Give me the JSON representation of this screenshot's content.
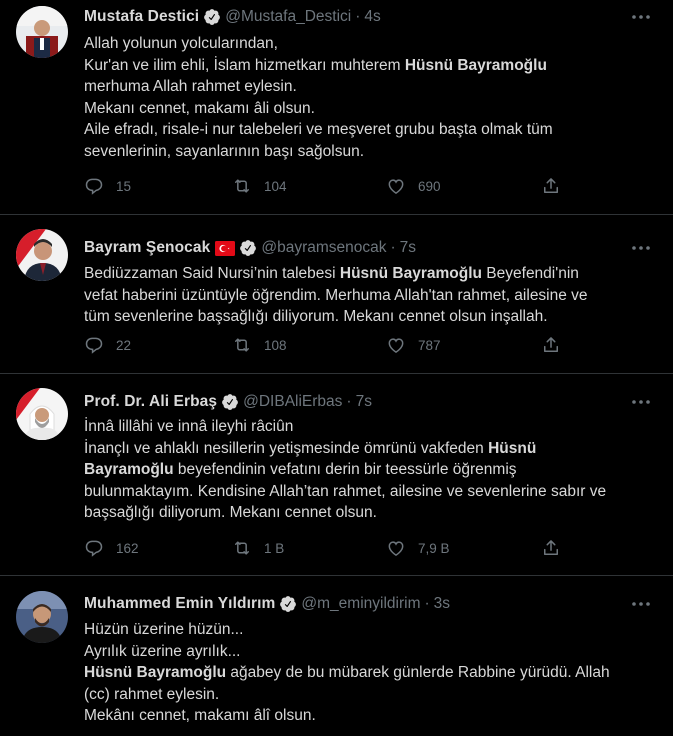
{
  "tweets": [
    {
      "name": "Mustafa Destici",
      "handle": "@Mustafa_Destici",
      "dot": "·",
      "time": "4s",
      "lines": [
        [
          "Allah yolunun yolcularından,"
        ],
        [
          "Kur'an ve ilim ehli, İslam hizmetkarı muhterem ",
          "Hüsnü Bayramoğlu"
        ],
        [
          "merhuma Allah rahmet eylesin."
        ],
        [
          "Mekanı cennet, makamı âli olsun."
        ],
        [
          "Aile efradı, risale-i nur talebeleri ve meşveret grubu  başta olmak tüm"
        ],
        [
          "sevenlerinin, sayanlarının başı sağolsun."
        ]
      ],
      "replies": "15",
      "retweets": "104",
      "likes": "690"
    },
    {
      "name": "Bayram Şenocak",
      "handle": "@bayramsenocak",
      "dot": "·",
      "time": "7s",
      "lines": [
        [
          "Bediüzzaman Said Nursi’nin talebesi ",
          "Hüsnü Bayramoğlu",
          " Beyefendi'nin"
        ],
        [
          "vefat haberini üzüntüyle öğrendim. Merhuma Allah'tan rahmet, ailesine ve"
        ],
        [
          "tüm sevenlerine başsağlığı diliyorum. Mekanı cennet olsun inşallah."
        ]
      ],
      "replies": "22",
      "retweets": "108",
      "likes": "787"
    },
    {
      "name": "Prof. Dr. Ali Erbaş",
      "handle": "@DIBAliErbas",
      "dot": "·",
      "time": "7s",
      "lines": [
        [
          "İnnâ lillâhi ve innâ ileyhi râciûn"
        ],
        [
          "İnançlı ve ahlaklı nesillerin yetişmesinde ömrünü vakfeden ",
          "Hüsnü"
        ],
        [
          "",
          "Bayramoğlu",
          " beyefendinin vefatını derin bir teessürle öğrenmiş"
        ],
        [
          "bulunmaktayım. Kendisine Allah’tan rahmet, ailesine ve sevenlerine sabır ve"
        ],
        [
          "başsağlığı diliyorum. Mekanı cennet olsun."
        ]
      ],
      "replies": "162",
      "retweets": "1 B",
      "likes": "7,9 B"
    },
    {
      "name": "Muhammed Emin Yıldırım",
      "handle": "@m_eminyildirim",
      "dot": "·",
      "time": "3s",
      "lines": [
        [
          "Hüzün üzerine hüzün..."
        ],
        [
          "Ayrılık üzerine ayrılık..."
        ],
        [
          "",
          "Hüsnü Bayramoğlu",
          " ağabey de bu mübarek günlerde Rabbine yürüdü. Allah"
        ],
        [
          "(cc) rahmet eylesin."
        ],
        [
          "Mekânı cennet, makamı âlî olsun."
        ]
      ]
    }
  ],
  "colors": {
    "background": "#000000",
    "text": "#d9d9d9",
    "muted": "#6e767d",
    "divider": "#2f3336",
    "verified": "#d9d9d9"
  },
  "icons": [
    "reply-icon",
    "retweet-icon",
    "like-icon",
    "share-icon",
    "more-icon",
    "verified-icon",
    "turkey-flag-icon"
  ]
}
